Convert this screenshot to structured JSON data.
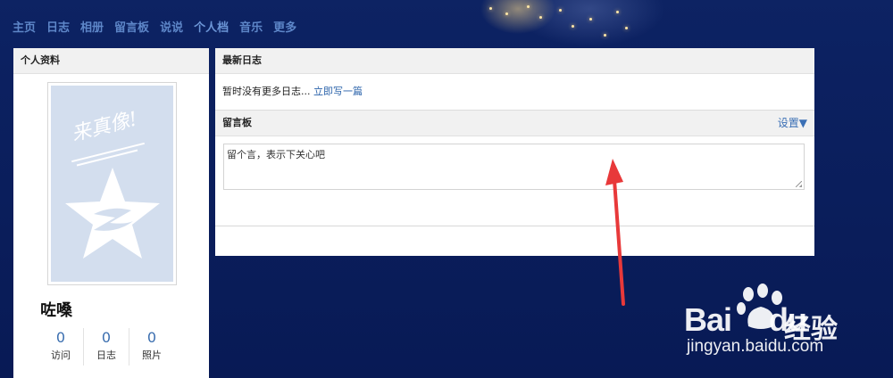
{
  "nav": {
    "items": [
      "主页",
      "日志",
      "相册",
      "留言板",
      "说说",
      "个人档",
      "音乐",
      "更多"
    ]
  },
  "profile": {
    "title": "个人资料",
    "avatar_text": "来真像!",
    "name": "咗嗓",
    "stats": [
      {
        "value": "0",
        "label": "访问"
      },
      {
        "value": "0",
        "label": "日志"
      },
      {
        "value": "0",
        "label": "照片"
      }
    ]
  },
  "blog": {
    "title": "最新日志",
    "empty_text": "暂时没有更多日志...",
    "link": "立即写一篇"
  },
  "guestbook": {
    "title": "留言板",
    "settings": "设置▼",
    "placeholder": "留个言，表示下关心吧"
  },
  "watermark": {
    "brand": "Bai",
    "brand2": "du",
    "product": "经验",
    "url": "jingyan.baidu.com"
  },
  "colors": {
    "link": "#2a62aa",
    "nav": "#5d86c8",
    "arrow": "#e8393a",
    "background": "#0b1f5c"
  }
}
